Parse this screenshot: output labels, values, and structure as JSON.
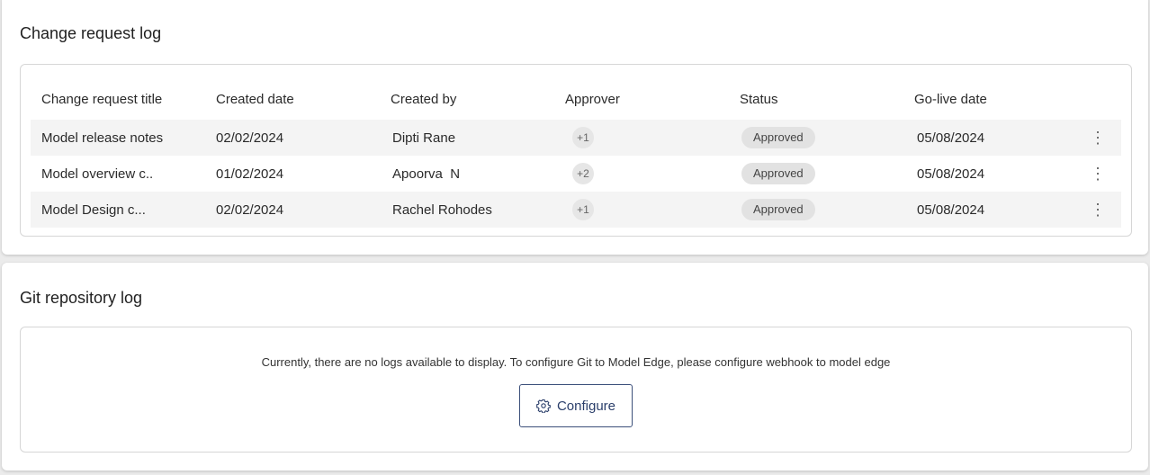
{
  "change_request_log": {
    "title": "Change request log",
    "columns": [
      "Change request title",
      "Created date",
      "Created by",
      "Approver",
      "Status",
      "Go-live date"
    ],
    "rows": [
      {
        "title": "Model release notes",
        "created_date": "02/02/2024",
        "created_by": "Dipti Rane",
        "approver": "+1",
        "status": "Approved",
        "go_live": "05/08/2024",
        "menu": "⋮"
      },
      {
        "title": "Model overview c..",
        "created_date": "01/02/2024",
        "created_by": "Apoorva  N",
        "approver": "+2",
        "status": "Approved",
        "go_live": "05/08/2024",
        "menu": "⋮"
      },
      {
        "title": "Model Design c...",
        "created_date": "02/02/2024",
        "created_by": "Rachel Rohodes",
        "approver": "+1",
        "status": "Approved",
        "go_live": "05/08/2024",
        "menu": "⋮"
      }
    ]
  },
  "git_repository_log": {
    "title": "Git repository log",
    "empty_message": "Currently, there are no logs available to display. To configure Git to Model Edge, please configure webhook to model edge",
    "configure_label": "Configure",
    "configure_icon": "gear-icon"
  },
  "colors": {
    "accent": "#2b3f6b",
    "status_badge_bg": "#e2e2e2",
    "row_shade": "#f4f4f4"
  }
}
